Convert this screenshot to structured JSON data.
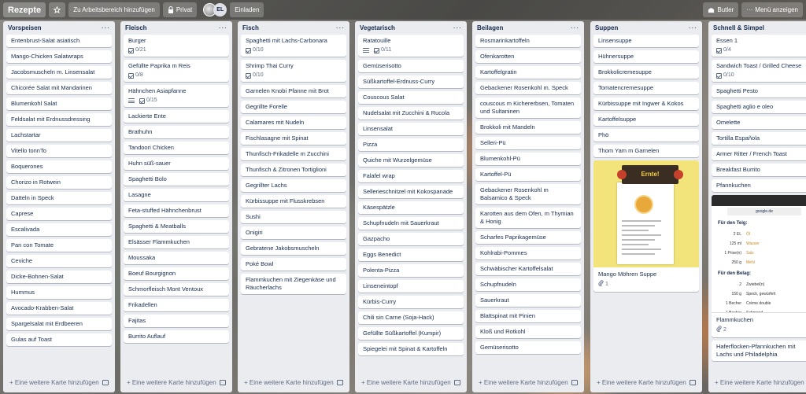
{
  "topbar": {
    "board_title": "Rezepte",
    "star_icon": "star-icon",
    "workspace_button": "Zu Arbeitsbereich hinzufügen",
    "visibility_button": "Privat",
    "avatar_initials": "EL",
    "invite_button": "Einladen",
    "butler_button": "Butler",
    "menu_button": "Menü anzeigen"
  },
  "add_card_label": "Eine weitere Karte hinzufügen",
  "lists": [
    {
      "title": "Vorspeisen",
      "cards": [
        {
          "title": "Entenbrust-Salat asiatisch"
        },
        {
          "title": "Mango-Chicken Salatwraps"
        },
        {
          "title": "Jacobsmuscheln m. Linsensalat"
        },
        {
          "title": "Chicorée Salat mit Mandarinen"
        },
        {
          "title": "Blumenkohl Salat"
        },
        {
          "title": "Feldsalat mit Erdnussdressing"
        },
        {
          "title": "Lachstartar"
        },
        {
          "title": "Vitello tonnTo"
        },
        {
          "title": "Boquerones"
        },
        {
          "title": "Chorizo in Rotwein"
        },
        {
          "title": "Datteln in Speck"
        },
        {
          "title": "Caprese"
        },
        {
          "title": "Escalivada"
        },
        {
          "title": "Pan con Tomate"
        },
        {
          "title": "Ceviche"
        },
        {
          "title": "Dicke-Bohnen-Salat"
        },
        {
          "title": "Hummus"
        },
        {
          "title": "Avocado-Krabben-Salat"
        },
        {
          "title": "Spargelsalat mit Erdbeeren"
        },
        {
          "title": "Gulas auf Toast"
        }
      ]
    },
    {
      "title": "Fleisch",
      "cards": [
        {
          "title": "Burger",
          "checklist": "0/21"
        },
        {
          "title": "Gefüllte Paprika m Reis",
          "checklist": "0/8"
        },
        {
          "title": "Hähnchen Asiapfanne",
          "description": true,
          "checklist": "0/15"
        },
        {
          "title": "Lackierte Ente"
        },
        {
          "title": "Brathuhn"
        },
        {
          "title": "Tandoori Chicken"
        },
        {
          "title": "Huhn süß-sauer"
        },
        {
          "title": "Spaghetti Bolo"
        },
        {
          "title": "Lasagne"
        },
        {
          "title": "Feta-stuffed Hähnchenbrust"
        },
        {
          "title": "Spaghetti & Meatballs"
        },
        {
          "title": "Elsässer Flammkuchen"
        },
        {
          "title": "Moussaka"
        },
        {
          "title": "Boeuf Bourgignon"
        },
        {
          "title": "Schmorfleisch Mont Ventoux"
        },
        {
          "title": "Frikadellen"
        },
        {
          "title": "Fajitas"
        },
        {
          "title": "Burrito Auflauf"
        }
      ]
    },
    {
      "title": "Fisch",
      "cards": [
        {
          "title": "Spaghetti mit Lachs-Carbonara",
          "checklist": "0/10"
        },
        {
          "title": "Shrimp Thai Curry",
          "checklist": "0/10"
        },
        {
          "title": "Garnelen Knobi Pfanne mit Brot"
        },
        {
          "title": "Gegrillte Forelle"
        },
        {
          "title": "Calamares mit Nudeln"
        },
        {
          "title": "Fischlasagne mit Spinat"
        },
        {
          "title": "Thunfisch-Frikadelle m Zucchini"
        },
        {
          "title": "Thunfisch & Zitronen Tortiglioni"
        },
        {
          "title": "Gegrillter Lachs"
        },
        {
          "title": "Kürbissuppe mit Flusskrebsen"
        },
        {
          "title": "Sushi"
        },
        {
          "title": "Onigiri"
        },
        {
          "title": "Gebratene Jakobsmuscheln"
        },
        {
          "title": "Poké Bowl"
        },
        {
          "title": "Flammkuchen mit Ziegenkäse und Räucherlachs"
        }
      ]
    },
    {
      "title": "Vegetarisch",
      "cards": [
        {
          "title": "Ratatouille",
          "description": true,
          "checklist": "0/11"
        },
        {
          "title": "Gemüserisotto"
        },
        {
          "title": "Süßkartoffel-Erdnuss-Curry"
        },
        {
          "title": "Couscous Salat"
        },
        {
          "title": "Nudelsalat mit Zucchini & Rucola"
        },
        {
          "title": "Linsensalat"
        },
        {
          "title": "Pizza"
        },
        {
          "title": "Quiche mit Wurzelgemüse"
        },
        {
          "title": "Falafel wrap"
        },
        {
          "title": "Sellerieschnitzel mit Kokospanade"
        },
        {
          "title": "Käsespätzle"
        },
        {
          "title": "Schupfnudeln mit Sauerkraut"
        },
        {
          "title": "Gazpacho"
        },
        {
          "title": "Eggs Benedict"
        },
        {
          "title": "Polenta-Pizza"
        },
        {
          "title": "Linseneintopf"
        },
        {
          "title": "Kürbis-Curry"
        },
        {
          "title": "Chili sin Carne (Soja-Hack)"
        },
        {
          "title": "Gefüllte Süßkartoffel (Kumpir)"
        },
        {
          "title": "Spiegelei mit Spinat & Kartoffeln"
        }
      ]
    },
    {
      "title": "Beilagen",
      "cards": [
        {
          "title": "Rosmarinkartoffeln"
        },
        {
          "title": "Ofenkarotten"
        },
        {
          "title": "Kartoffelgratin"
        },
        {
          "title": "Gebackener Rosenkohl m. Speck"
        },
        {
          "title": "couscous m Kichererbsen, Tomaten und Sultaninen"
        },
        {
          "title": "Brokkoli mit Mandeln"
        },
        {
          "title": "Selleri-Pü"
        },
        {
          "title": "Blumenkohl-Pü"
        },
        {
          "title": "Kartoffel-Pü"
        },
        {
          "title": "Gebackener Rosenkohl m Balsamico & Speck"
        },
        {
          "title": "Karotten aus dem Ofen, m Thymian & Honig"
        },
        {
          "title": "Scharfes Paprikagemüse"
        },
        {
          "title": "Kohlrabi-Pommes"
        },
        {
          "title": "Schwäbischer Kartoffelsalat"
        },
        {
          "title": "Schupfnudeln"
        },
        {
          "title": "Sauerkraut"
        },
        {
          "title": "Blattspinat mit Pinien"
        },
        {
          "title": "Kloß und Rotkohl"
        },
        {
          "title": "Gemüserisotto"
        }
      ]
    },
    {
      "title": "Suppen",
      "cards": [
        {
          "title": "Linsensuppe"
        },
        {
          "title": "Hühnersuppe"
        },
        {
          "title": "Brokkolicremesuppe"
        },
        {
          "title": "Tomatencremesuppe"
        },
        {
          "title": "Kürbissuppe mit Ingwer & Kokos"
        },
        {
          "title": "Kartoffelsuppe"
        },
        {
          "title": "Phö"
        },
        {
          "title": "Thom Yam m Garnelen"
        },
        {
          "title": "Mango Möhren Suppe",
          "cover": "recipe-sheet",
          "attachments": "1"
        }
      ]
    },
    {
      "title": "Schnell & Simpel",
      "cards": [
        {
          "title": "Essen 1",
          "checklist": "0/4"
        },
        {
          "title": "Sandwich Toast / Grilled Cheese",
          "checklist": "0/10"
        },
        {
          "title": "Spaghetti Pesto"
        },
        {
          "title": "Spaghetti aglio e oleo"
        },
        {
          "title": "Omelette"
        },
        {
          "title": "Tortilla Española"
        },
        {
          "title": "Armer Ritter / French Toast"
        },
        {
          "title": "Breakfast Burrito"
        },
        {
          "title": "Pfannkuchen"
        },
        {
          "title": "Flammkuchen",
          "cover": "phone-screenshot",
          "attachments": "2"
        },
        {
          "title": "Haferflocken-Pfannkuchen mit Lachs und Philadelphia"
        }
      ]
    }
  ],
  "cover_recipe": {
    "banner": "Ernte!"
  },
  "cover_phone": {
    "url": "google.de",
    "section1": "Für den Teig:",
    "rows1": [
      [
        "2 EL",
        "Öl"
      ],
      [
        "125 ml",
        "Wasser"
      ],
      [
        "1 Prise(n)",
        "Salz"
      ],
      [
        "250 g",
        "Mehl"
      ]
    ],
    "section2": "Für den Belag:",
    "rows2": [
      [
        "2",
        "Zwiebel(n)"
      ],
      [
        "150 g",
        "Speck, gewürfelt"
      ],
      [
        "1 Becher",
        "Crème double"
      ],
      [
        "1 Becher",
        "Schmand"
      ]
    ]
  }
}
